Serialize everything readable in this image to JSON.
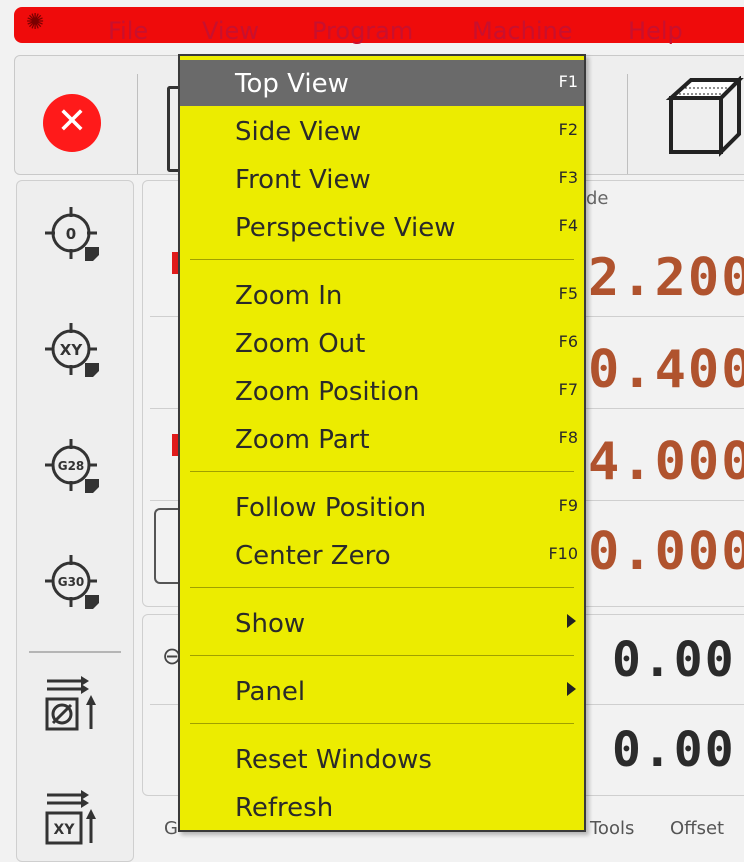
{
  "menubar": {
    "items": [
      "File",
      "View",
      "Program",
      "Machine",
      "Help"
    ]
  },
  "dro": {
    "header_text": "de",
    "values": [
      "2.200",
      "0.400",
      "4.000",
      "0.000"
    ]
  },
  "offsets": {
    "values": [
      "0.00",
      "0.00"
    ]
  },
  "bottom_tabs": [
    "G",
    "Tools",
    "Offset"
  ],
  "view_menu": {
    "items": [
      {
        "label": "Top View",
        "shortcut": "F1",
        "active": true
      },
      {
        "label": "Side View",
        "shortcut": "F2"
      },
      {
        "label": "Front View",
        "shortcut": "F3"
      },
      {
        "label": "Perspective View",
        "shortcut": "F4"
      },
      {
        "label": "Zoom In",
        "shortcut": "F5"
      },
      {
        "label": "Zoom Out",
        "shortcut": "F6"
      },
      {
        "label": "Zoom Position",
        "shortcut": "F7"
      },
      {
        "label": "Zoom Part",
        "shortcut": "F8"
      },
      {
        "label": "Follow Position",
        "shortcut": "F9"
      },
      {
        "label": "Center Zero",
        "shortcut": "F10"
      },
      {
        "label": "Show",
        "submenu": true
      },
      {
        "label": "Panel",
        "submenu": true
      },
      {
        "label": "Reset Windows",
        "shortcut": ""
      },
      {
        "label": "Refresh",
        "shortcut": ""
      }
    ]
  },
  "goto_buttons": [
    "0",
    "XY",
    "G28",
    "G30"
  ],
  "colors": {
    "menubar_bg": "#ef0b0b",
    "menu_bg": "#ecec00",
    "menu_highlight": "#6a6a6a",
    "dro_value": "#b0532e"
  }
}
